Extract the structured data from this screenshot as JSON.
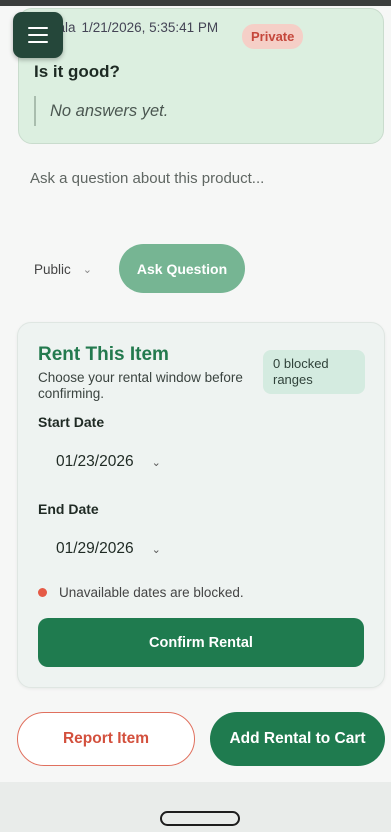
{
  "question_card": {
    "author": "nala",
    "date": "1/21/2026, 5:35:41 PM",
    "visibility_badge": "Private",
    "question": "Is it good?",
    "answer_placeholder": "No answers yet."
  },
  "ask": {
    "placeholder": "Ask a question about this product...",
    "visibility_value": "Public",
    "button_label": "Ask Question"
  },
  "rental": {
    "title": "Rent This Item",
    "subtitle": "Choose your rental window before confirming.",
    "blocked_badge": "0 blocked ranges",
    "start_label": "Start Date",
    "start_value": "01/23/2026",
    "end_label": "End Date",
    "end_value": "01/29/2026",
    "note": "Unavailable dates are blocked.",
    "confirm_label": "Confirm Rental"
  },
  "footer": {
    "report_label": "Report Item",
    "cart_label": "Add Rental to Cart"
  },
  "colors": {
    "primary": "#1f7b4f",
    "ask_button": "#76b593",
    "private_badge_text": "#c5473b",
    "danger_dot": "#e55a46"
  },
  "icons": {
    "menu": "hamburger-menu-icon",
    "chevron": "chevron-down-icon"
  }
}
